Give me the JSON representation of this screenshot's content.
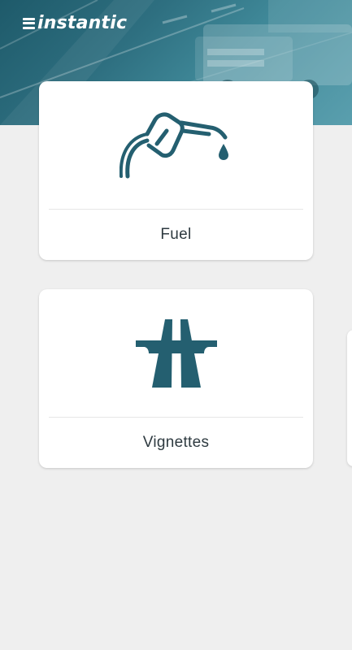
{
  "app": {
    "brand_name": "instantic"
  },
  "theme": {
    "accent": "#245f70",
    "background": "#efefef",
    "card": "#ffffff"
  },
  "services": [
    {
      "label": "Fuel",
      "icon": "fuel-pump-icon"
    },
    {
      "label": "Vignettes",
      "icon": "highway-icon"
    }
  ]
}
